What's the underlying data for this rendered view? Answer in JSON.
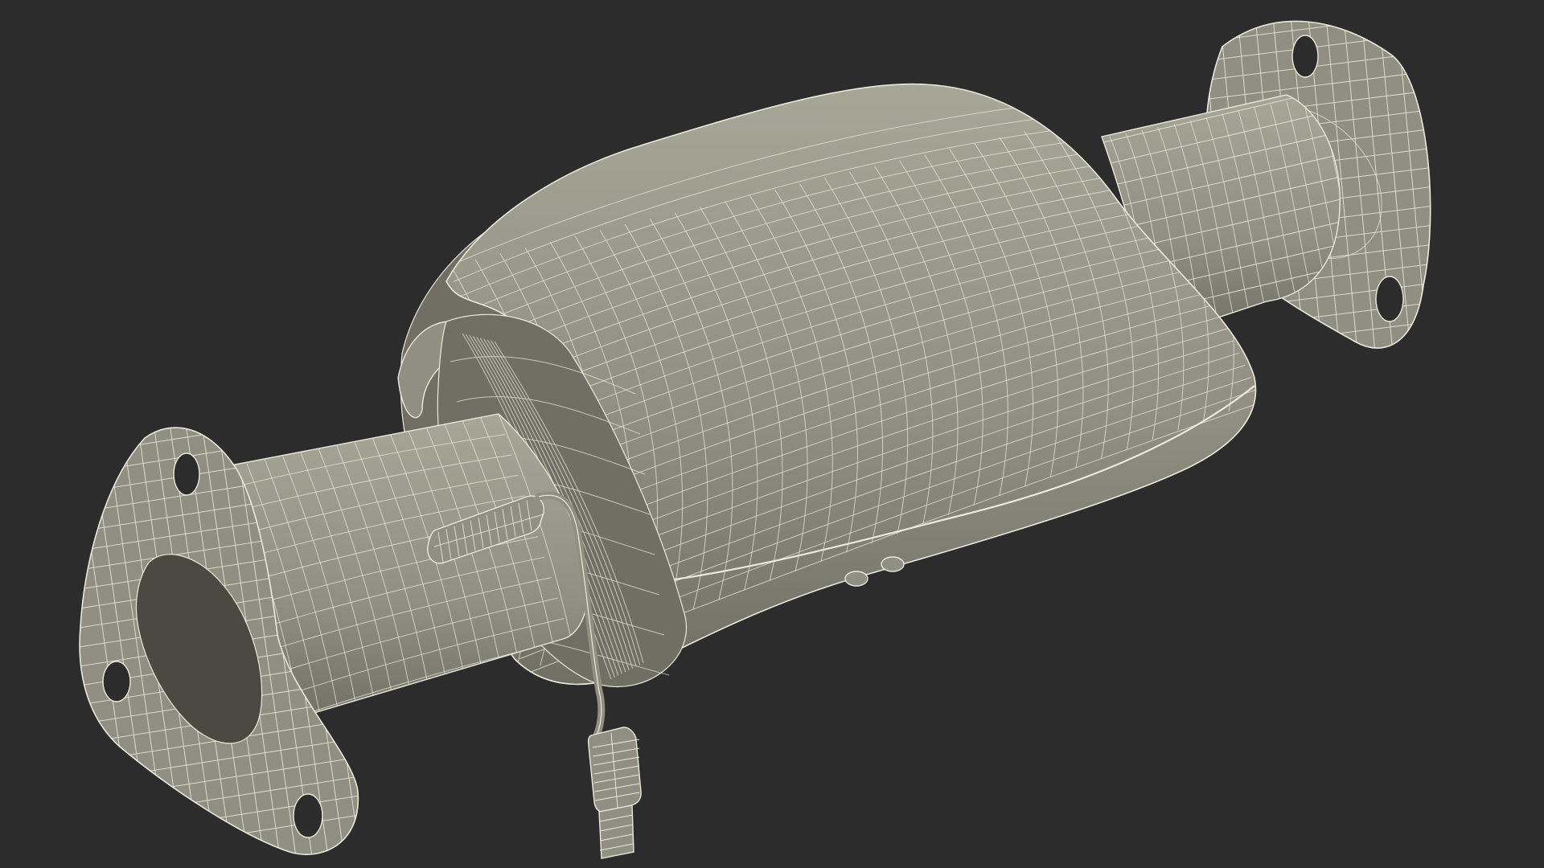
{
  "scene": {
    "subject": "catalytic-converter-wireframe",
    "render_style": "wireframe-on-solid",
    "colors": {
      "background": "#2c2c2c",
      "surface": "#8f8f82",
      "surface_dark": "#6f6f64",
      "surface_light": "#a7a798",
      "inner_dark": "#4a4a42",
      "wire": "#e9e9dc"
    }
  }
}
